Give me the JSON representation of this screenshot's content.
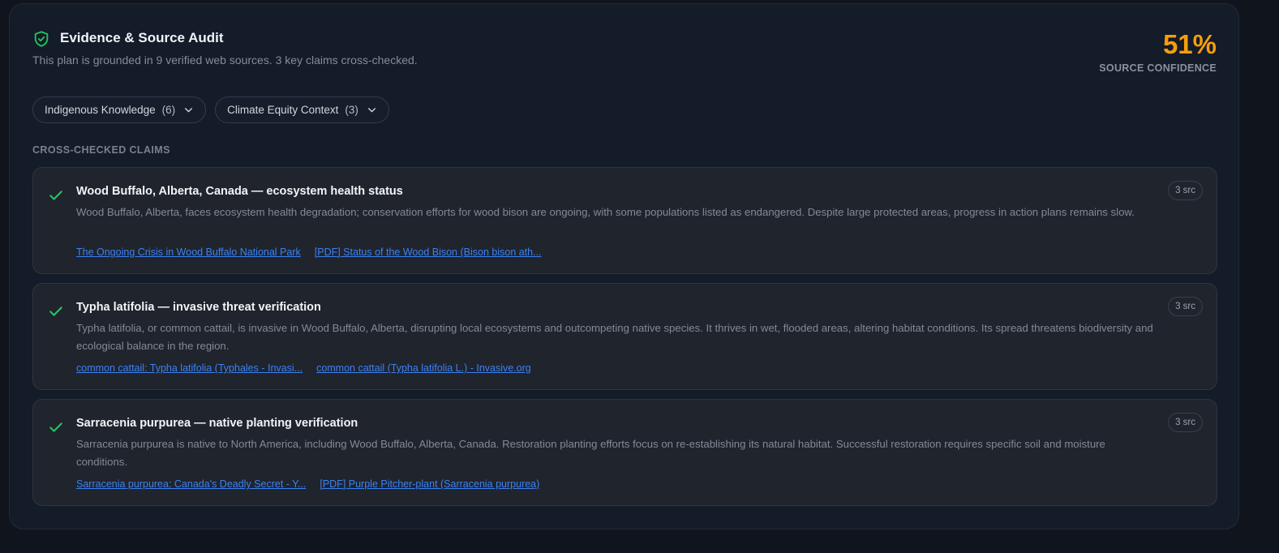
{
  "header": {
    "title": "Evidence & Source Audit",
    "subtitle": "This plan is grounded in 9 verified web sources. 3 key claims cross-checked.",
    "icon": "shield-check-icon"
  },
  "confidence": {
    "value": "51%",
    "label": "SOURCE CONFIDENCE",
    "color": "#f59e0b"
  },
  "filters": [
    {
      "label": "Indigenous Knowledge",
      "count": "(6)"
    },
    {
      "label": "Climate Equity Context",
      "count": "(3)"
    }
  ],
  "section_label": "CROSS-CHECKED CLAIMS",
  "claims": [
    {
      "title": "Wood Buffalo, Alberta, Canada — ecosystem health status",
      "body": "Wood Buffalo, Alberta, faces ecosystem health degradation; conservation efforts for wood bison are ongoing, with some populations listed as endangered. Despite large protected areas, progress in action plans remains slow.",
      "links": [
        "The Ongoing Crisis in Wood Buffalo National Park",
        "[PDF] Status of the Wood Bison (Bison bison ath..."
      ],
      "badge": "3 src"
    },
    {
      "title": "Typha latifolia — invasive threat verification",
      "body": "Typha latifolia, or common cattail, is invasive in Wood Buffalo, Alberta, disrupting local ecosystems and outcompeting native species. It thrives in wet, flooded areas, altering habitat conditions. Its spread threatens biodiversity and ecological balance in the region.",
      "links": [
        "common cattail: Typha latifolia (Typhales - Invasi...",
        "common cattail (Typha latifolia L.) - Invasive.org"
      ],
      "badge": "3 src"
    },
    {
      "title": "Sarracenia purpurea — native planting verification",
      "body": "Sarracenia purpurea is native to North America, including Wood Buffalo, Alberta, Canada. Restoration planting efforts focus on re-establishing its natural habitat. Successful restoration requires specific soil and moisture conditions.",
      "links": [
        "Sarracenia purpurea: Canada's Deadly Secret - Y...",
        "[PDF] Purple Pitcher-plant (Sarracenia purpurea)"
      ],
      "badge": "3 src"
    }
  ],
  "colors": {
    "accent_green": "#22c55e",
    "link_blue": "#3b82f6",
    "confidence_orange": "#f59e0b"
  }
}
